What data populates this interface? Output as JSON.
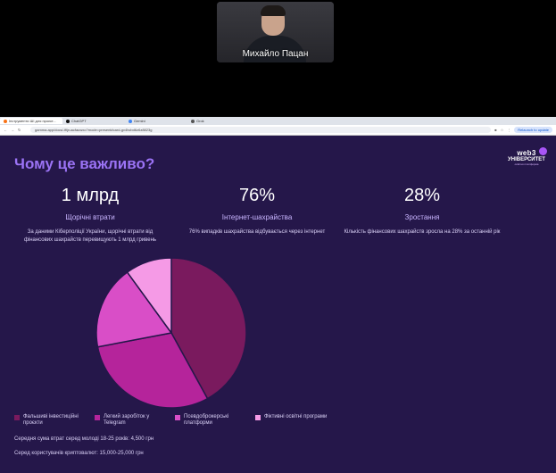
{
  "video": {
    "participant_name": "Михайло Пацан"
  },
  "browser": {
    "tabs": [
      {
        "label": "Інструменти ШІ для проєкт...",
        "color": "#f97316"
      },
      {
        "label": "ChatGPT",
        "color": "#111111"
      },
      {
        "label": "Gemini",
        "color": "#4285f4"
      },
      {
        "label": "Grok",
        "color": "#555555"
      }
    ],
    "url": "gamma.app/docs/-ffijruacfauwxo?mode=present#card-gv4hcbd6z6z8823g",
    "relaunch_label": "Relaunch to update"
  },
  "slide": {
    "title": "Чому це важливо?",
    "logo": {
      "line1": "web3",
      "line2": "УНІВЕРСИТЕТ",
      "line3": "освітня платформа"
    },
    "stats": [
      {
        "value": "1 млрд",
        "label": "Щорічні втрати",
        "desc": "За даними Кіберполіції України, щорічні втрати від фінансових шахрайств перевищують 1 млрд гривень"
      },
      {
        "value": "76%",
        "label": "Інтернет-шахрайства",
        "desc": "76% випадків шахрайства відбувається через інтернет"
      },
      {
        "value": "28%",
        "label": "Зростання",
        "desc": "Кількість фінансових шахрайств зросла на 28% за останній рік"
      }
    ],
    "notes": [
      "Середня сума втрат серед молоді 18-25 років: 4,500 грн",
      "Серед користувачів криптовалют: 15,000-25,000 грн"
    ]
  },
  "chart_data": {
    "type": "pie",
    "categories": [
      "Фальшиві інвестиційні проєкти",
      "Легкий заробіток у Telegram",
      "Псевдоброкерські платформи",
      "Фіктивні освітні програми"
    ],
    "values": [
      42,
      30,
      18,
      10
    ],
    "colors": [
      "#7a1a5e",
      "#b5249b",
      "#d94ec7",
      "#f59ae6"
    ],
    "legend_position": "bottom"
  }
}
